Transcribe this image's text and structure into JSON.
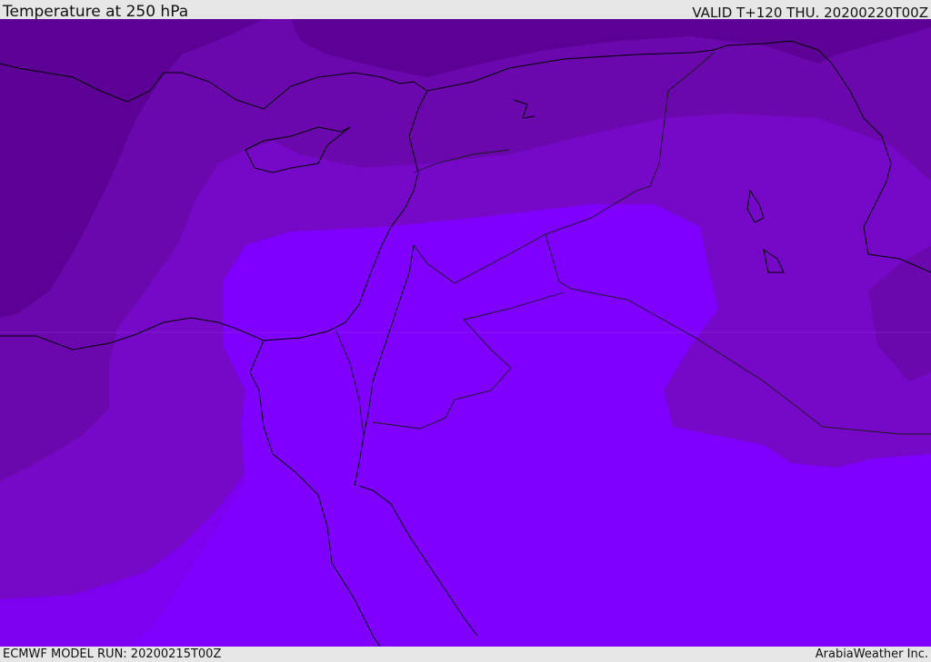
{
  "header": {
    "title": "Temperature at 250 hPa",
    "valid_time": "VALID T+120 THU. 20200220T00Z"
  },
  "footer": {
    "model_run": "ECMWF MODEL RUN: 20200215T00Z",
    "credit": "ArabiaWeather Inc."
  },
  "map": {
    "variable": "Temperature",
    "level": "250 hPa",
    "region": "Eastern Mediterranean / Middle East",
    "colors": {
      "coldest": "#5c0096",
      "cold": "#6a08ad",
      "mid": "#7608c8",
      "warm": "#7d00f0",
      "warmest": "#7f00ff",
      "coastline": "#000000",
      "border": "#1a1a1a"
    }
  }
}
